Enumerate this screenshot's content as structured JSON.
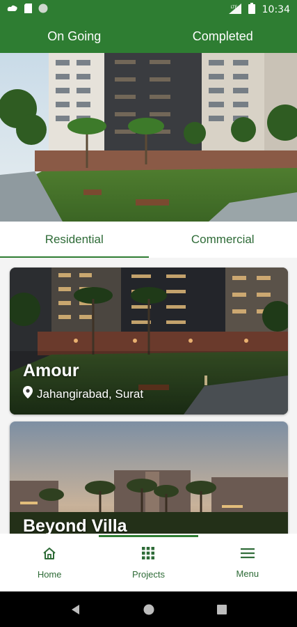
{
  "status_bar": {
    "time": "10:34",
    "left_icons": [
      "cloud-icon",
      "sim-icon",
      "circle-icon"
    ],
    "right_icons": [
      "signal-icon",
      "battery-icon"
    ]
  },
  "top_tabs": [
    {
      "label": "On Going",
      "active": true
    },
    {
      "label": "Completed",
      "active": false
    }
  ],
  "sub_tabs": [
    {
      "label": "Residential",
      "active": true
    },
    {
      "label": "Commercial",
      "active": false
    }
  ],
  "projects": [
    {
      "name": "Amour",
      "location": "Jahangirabad, Surat",
      "location_icon": "location-pin-icon"
    },
    {
      "name": "Beyond Villa"
    }
  ],
  "bottom_nav": [
    {
      "label": "Home",
      "icon": "home-icon",
      "active": false
    },
    {
      "label": "Projects",
      "icon": "grid-icon",
      "active": true
    },
    {
      "label": "Menu",
      "icon": "hamburger-menu-icon",
      "active": false
    }
  ],
  "system_nav": [
    "back-icon",
    "home-circle-icon",
    "recents-icon"
  ],
  "colors": {
    "brand_green": "#2e7d32",
    "label_green": "#2e6b37",
    "background": "#f4f4f4"
  }
}
